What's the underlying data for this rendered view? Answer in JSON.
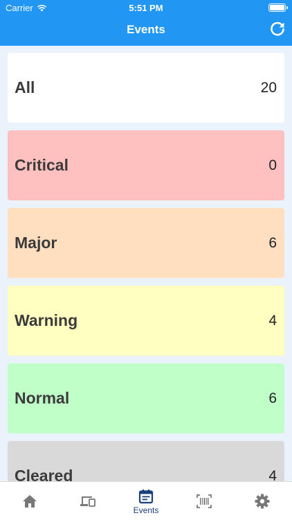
{
  "status_bar": {
    "carrier": "Carrier",
    "time": "5:51 PM"
  },
  "header": {
    "title": "Events",
    "refresh_icon": "refresh-icon",
    "background": "#2196f3"
  },
  "events": [
    {
      "label": "All",
      "count": "20",
      "color": "#ffffff"
    },
    {
      "label": "Critical",
      "count": "0",
      "color": "#ffc0c0"
    },
    {
      "label": "Major",
      "count": "6",
      "color": "#ffdfc0"
    },
    {
      "label": "Warning",
      "count": "4",
      "color": "#ffffc0"
    },
    {
      "label": "Normal",
      "count": "6",
      "color": "#c0ffc8"
    },
    {
      "label": "Cleared",
      "count": "4",
      "color": "#d9d9d9"
    }
  ],
  "tabbar": {
    "tabs": [
      {
        "icon": "home-icon",
        "label": ""
      },
      {
        "icon": "devices-icon",
        "label": ""
      },
      {
        "icon": "calendar-icon",
        "label": "Events",
        "active": true
      },
      {
        "icon": "barcode-icon",
        "label": ""
      },
      {
        "icon": "gear-icon",
        "label": ""
      }
    ],
    "active_color": "#1a3f7a",
    "inactive_color": "#777777"
  }
}
